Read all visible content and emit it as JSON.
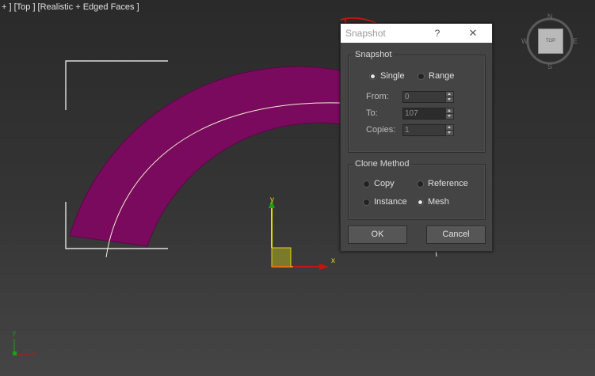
{
  "viewport": {
    "label": "+ ] [Top ] [Realistic + Edged Faces ]",
    "gizmo_x_label": "x",
    "gizmo_y_label": "y",
    "mini_axis_x": "x",
    "mini_axis_y": "y"
  },
  "viewcube": {
    "face": "TOP",
    "north": "N",
    "south": "S",
    "west": "W",
    "east": "E"
  },
  "dialog": {
    "title": "Snapshot",
    "help": "?",
    "close": "✕",
    "snapshot_group": {
      "title": "Snapshot",
      "single_label": "Single",
      "range_label": "Range",
      "selected": "Single",
      "from_label": "From:",
      "from_value": "0",
      "to_label": "To:",
      "to_value": "107",
      "copies_label": "Copies:",
      "copies_value": "1"
    },
    "clone_group": {
      "title": "Clone Method",
      "copy_label": "Copy",
      "reference_label": "Reference",
      "instance_label": "Instance",
      "mesh_label": "Mesh",
      "selected": "Mesh"
    },
    "ok_label": "OK",
    "cancel_label": "Cancel"
  },
  "colors": {
    "arc_fill": "#7a0a5e",
    "spline": "#f0f0d0",
    "annotation": "#dd1111",
    "axis_x": "#cc1111",
    "axis_y": "#e8d800"
  }
}
